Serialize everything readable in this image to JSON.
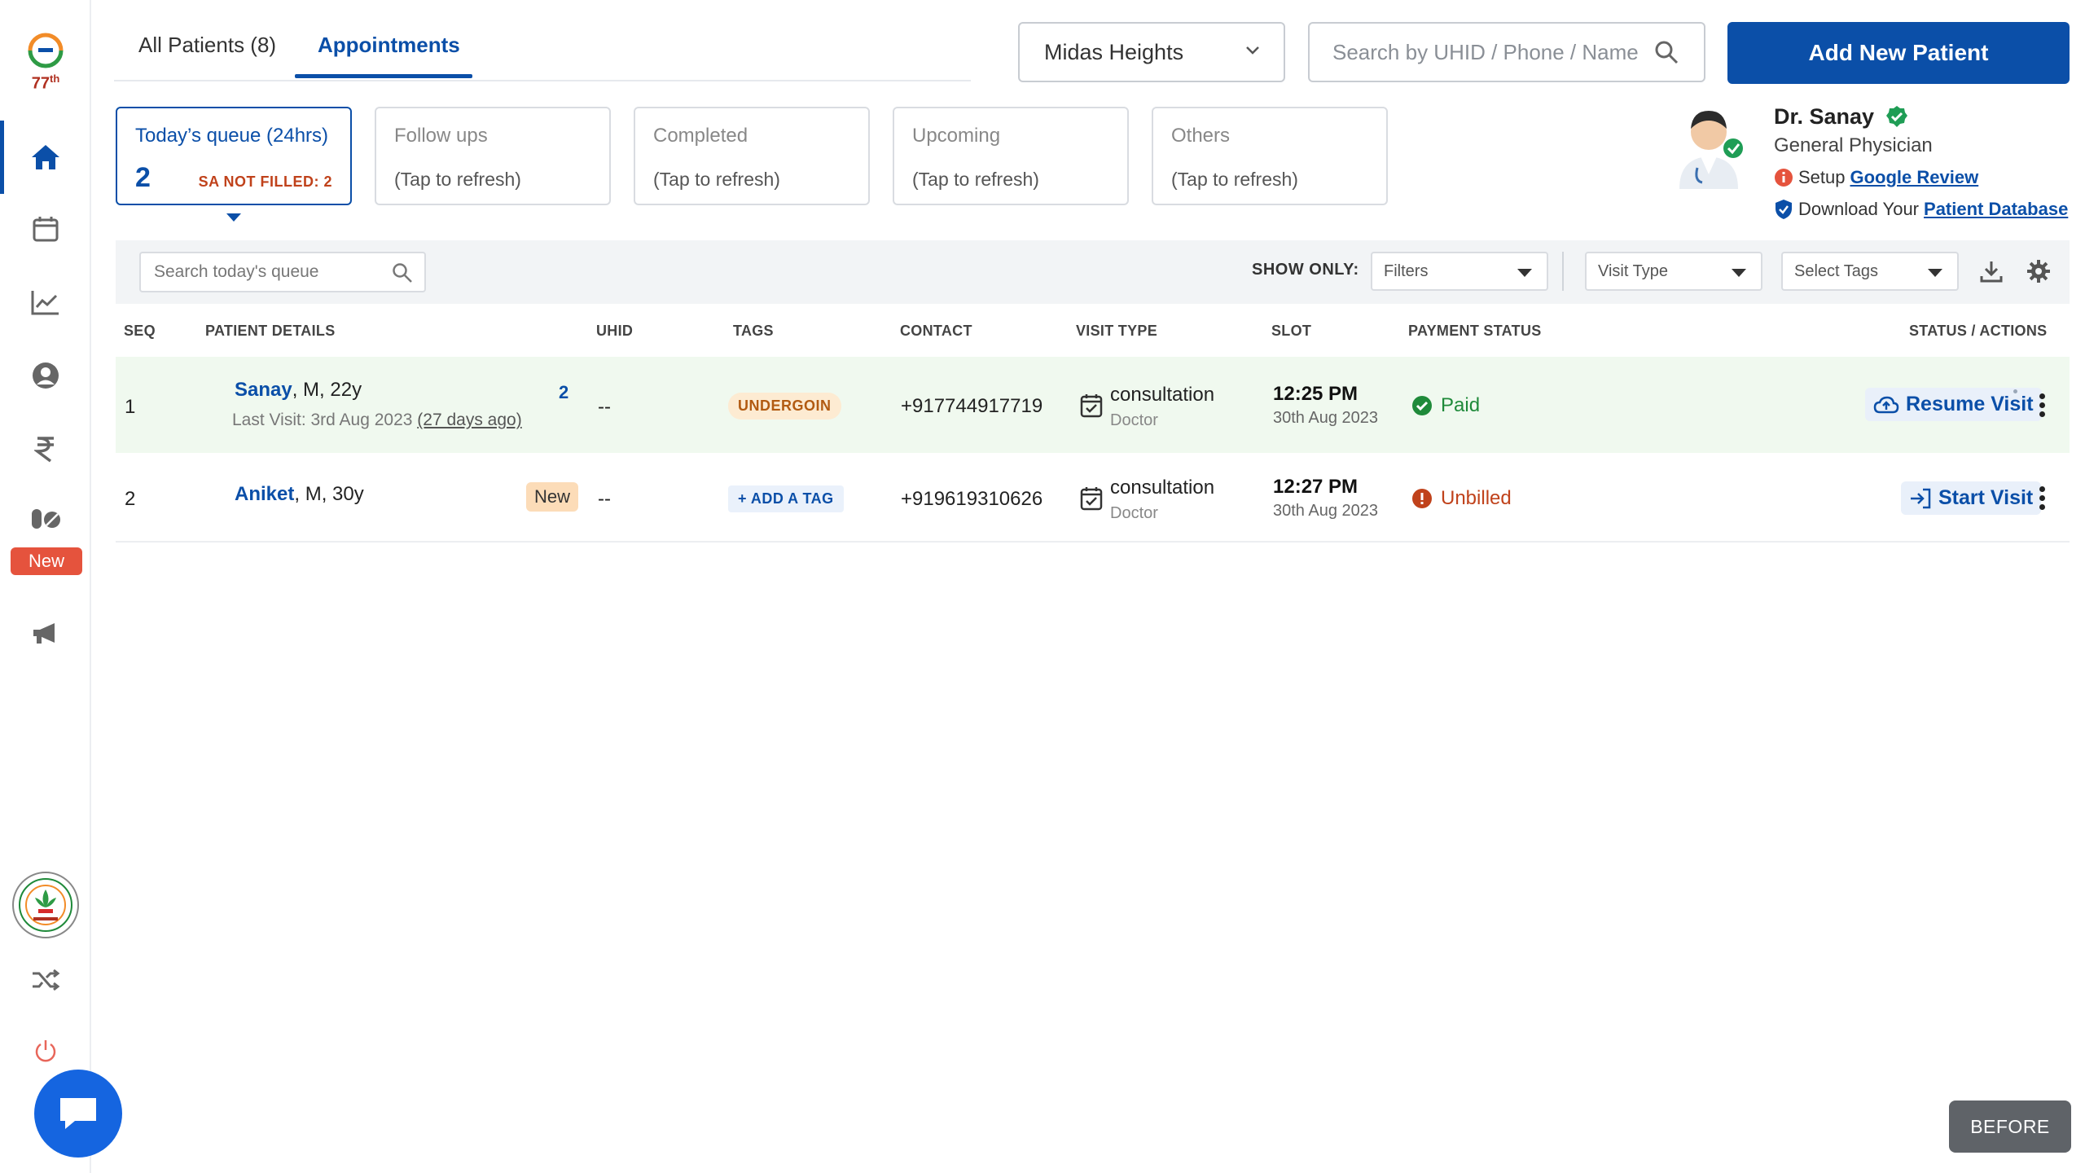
{
  "sidebar": {
    "logo_text": "77",
    "logo_sup": "th",
    "new_badge": "New"
  },
  "tabs": [
    {
      "label": "All Patients (8)"
    },
    {
      "label": "Appointments"
    }
  ],
  "header": {
    "location": "Midas Heights",
    "search_placeholder": "Search by UHID / Phone / Name",
    "add_button": "Add New Patient"
  },
  "queue_cards": [
    {
      "title": "Today’s queue (24hrs)",
      "count": "2",
      "warning": "SA NOT FILLED: 2"
    },
    {
      "title": "Follow ups",
      "sub": "(Tap to refresh)"
    },
    {
      "title": "Completed",
      "sub": "(Tap to refresh)"
    },
    {
      "title": "Upcoming",
      "sub": "(Tap to refresh)"
    },
    {
      "title": "Others",
      "sub": "(Tap to refresh)"
    }
  ],
  "doctor": {
    "name": "Dr. Sanay",
    "role": "General Physician",
    "setup_prefix": "Setup",
    "setup_link": "Google Review",
    "download_prefix": "Download Your",
    "download_link": "Patient Database"
  },
  "filters": {
    "queue_search_placeholder": "Search today's queue",
    "show_only": "SHOW ONLY:",
    "filters": "Filters",
    "visit_type": "Visit Type",
    "tags": "Select Tags"
  },
  "table": {
    "headers": [
      "SEQ",
      "PATIENT DETAILS",
      "UHID",
      "TAGS",
      "CONTACT",
      "VISIT TYPE",
      "SLOT",
      "PAYMENT STATUS",
      "STATUS / ACTIONS"
    ],
    "rows": [
      {
        "seq": "1",
        "name": "Sanay",
        "demo": ", M, 22y",
        "last_visit_prefix": "Last Visit: 3rd Aug 2023",
        "last_visit_ago": "(27 days ago)",
        "visits_badge": "2",
        "uhid": "--",
        "tag": "UNDERGOIN",
        "contact": "+917744917719",
        "visit_type": "consultation",
        "visit_sub": "Doctor",
        "slot_time": "12:25 PM",
        "slot_date": "30th Aug 2023",
        "payment": "Paid",
        "action": "Resume Visit"
      },
      {
        "seq": "2",
        "name": "Aniket",
        "demo": ", M, 30y",
        "new_tag": "New",
        "uhid": "--",
        "tag": "+ ADD A TAG",
        "contact": "+919619310626",
        "visit_type": "consultation",
        "visit_sub": "Doctor",
        "slot_time": "12:27 PM",
        "slot_date": "30th Aug 2023",
        "payment": "Unbilled",
        "action": "Start Visit"
      }
    ]
  },
  "footer": {
    "before_label": "BEFORE"
  },
  "colors": {
    "brand": "#0b4fa8",
    "paid": "#1f8a3a",
    "unbilled": "#c0421b",
    "row_active": "#f0f9ef"
  }
}
